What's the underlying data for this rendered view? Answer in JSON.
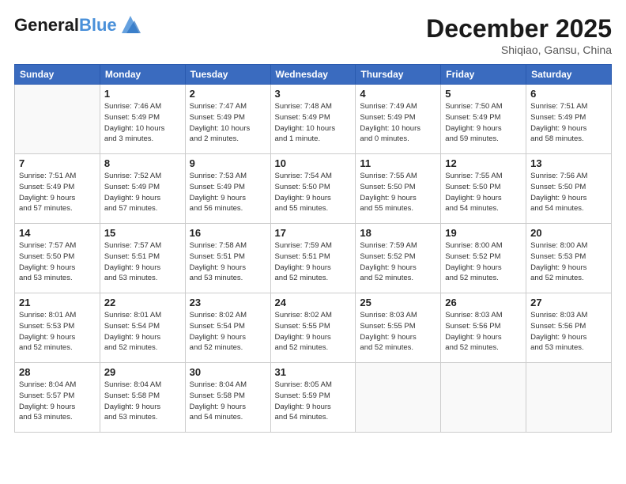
{
  "header": {
    "logo_line1": "General",
    "logo_line2": "Blue",
    "month": "December 2025",
    "location": "Shiqiao, Gansu, China"
  },
  "weekdays": [
    "Sunday",
    "Monday",
    "Tuesday",
    "Wednesday",
    "Thursday",
    "Friday",
    "Saturday"
  ],
  "weeks": [
    [
      {
        "day": "",
        "info": ""
      },
      {
        "day": "1",
        "info": "Sunrise: 7:46 AM\nSunset: 5:49 PM\nDaylight: 10 hours\nand 3 minutes."
      },
      {
        "day": "2",
        "info": "Sunrise: 7:47 AM\nSunset: 5:49 PM\nDaylight: 10 hours\nand 2 minutes."
      },
      {
        "day": "3",
        "info": "Sunrise: 7:48 AM\nSunset: 5:49 PM\nDaylight: 10 hours\nand 1 minute."
      },
      {
        "day": "4",
        "info": "Sunrise: 7:49 AM\nSunset: 5:49 PM\nDaylight: 10 hours\nand 0 minutes."
      },
      {
        "day": "5",
        "info": "Sunrise: 7:50 AM\nSunset: 5:49 PM\nDaylight: 9 hours\nand 59 minutes."
      },
      {
        "day": "6",
        "info": "Sunrise: 7:51 AM\nSunset: 5:49 PM\nDaylight: 9 hours\nand 58 minutes."
      }
    ],
    [
      {
        "day": "7",
        "info": "Sunrise: 7:51 AM\nSunset: 5:49 PM\nDaylight: 9 hours\nand 57 minutes."
      },
      {
        "day": "8",
        "info": "Sunrise: 7:52 AM\nSunset: 5:49 PM\nDaylight: 9 hours\nand 57 minutes."
      },
      {
        "day": "9",
        "info": "Sunrise: 7:53 AM\nSunset: 5:49 PM\nDaylight: 9 hours\nand 56 minutes."
      },
      {
        "day": "10",
        "info": "Sunrise: 7:54 AM\nSunset: 5:50 PM\nDaylight: 9 hours\nand 55 minutes."
      },
      {
        "day": "11",
        "info": "Sunrise: 7:55 AM\nSunset: 5:50 PM\nDaylight: 9 hours\nand 55 minutes."
      },
      {
        "day": "12",
        "info": "Sunrise: 7:55 AM\nSunset: 5:50 PM\nDaylight: 9 hours\nand 54 minutes."
      },
      {
        "day": "13",
        "info": "Sunrise: 7:56 AM\nSunset: 5:50 PM\nDaylight: 9 hours\nand 54 minutes."
      }
    ],
    [
      {
        "day": "14",
        "info": "Sunrise: 7:57 AM\nSunset: 5:50 PM\nDaylight: 9 hours\nand 53 minutes."
      },
      {
        "day": "15",
        "info": "Sunrise: 7:57 AM\nSunset: 5:51 PM\nDaylight: 9 hours\nand 53 minutes."
      },
      {
        "day": "16",
        "info": "Sunrise: 7:58 AM\nSunset: 5:51 PM\nDaylight: 9 hours\nand 53 minutes."
      },
      {
        "day": "17",
        "info": "Sunrise: 7:59 AM\nSunset: 5:51 PM\nDaylight: 9 hours\nand 52 minutes."
      },
      {
        "day": "18",
        "info": "Sunrise: 7:59 AM\nSunset: 5:52 PM\nDaylight: 9 hours\nand 52 minutes."
      },
      {
        "day": "19",
        "info": "Sunrise: 8:00 AM\nSunset: 5:52 PM\nDaylight: 9 hours\nand 52 minutes."
      },
      {
        "day": "20",
        "info": "Sunrise: 8:00 AM\nSunset: 5:53 PM\nDaylight: 9 hours\nand 52 minutes."
      }
    ],
    [
      {
        "day": "21",
        "info": "Sunrise: 8:01 AM\nSunset: 5:53 PM\nDaylight: 9 hours\nand 52 minutes."
      },
      {
        "day": "22",
        "info": "Sunrise: 8:01 AM\nSunset: 5:54 PM\nDaylight: 9 hours\nand 52 minutes."
      },
      {
        "day": "23",
        "info": "Sunrise: 8:02 AM\nSunset: 5:54 PM\nDaylight: 9 hours\nand 52 minutes."
      },
      {
        "day": "24",
        "info": "Sunrise: 8:02 AM\nSunset: 5:55 PM\nDaylight: 9 hours\nand 52 minutes."
      },
      {
        "day": "25",
        "info": "Sunrise: 8:03 AM\nSunset: 5:55 PM\nDaylight: 9 hours\nand 52 minutes."
      },
      {
        "day": "26",
        "info": "Sunrise: 8:03 AM\nSunset: 5:56 PM\nDaylight: 9 hours\nand 52 minutes."
      },
      {
        "day": "27",
        "info": "Sunrise: 8:03 AM\nSunset: 5:56 PM\nDaylight: 9 hours\nand 53 minutes."
      }
    ],
    [
      {
        "day": "28",
        "info": "Sunrise: 8:04 AM\nSunset: 5:57 PM\nDaylight: 9 hours\nand 53 minutes."
      },
      {
        "day": "29",
        "info": "Sunrise: 8:04 AM\nSunset: 5:58 PM\nDaylight: 9 hours\nand 53 minutes."
      },
      {
        "day": "30",
        "info": "Sunrise: 8:04 AM\nSunset: 5:58 PM\nDaylight: 9 hours\nand 54 minutes."
      },
      {
        "day": "31",
        "info": "Sunrise: 8:05 AM\nSunset: 5:59 PM\nDaylight: 9 hours\nand 54 minutes."
      },
      {
        "day": "",
        "info": ""
      },
      {
        "day": "",
        "info": ""
      },
      {
        "day": "",
        "info": ""
      }
    ]
  ]
}
